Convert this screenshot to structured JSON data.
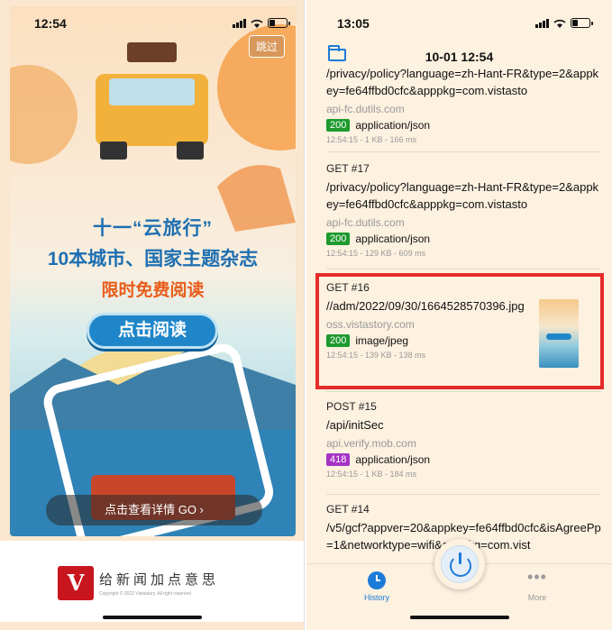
{
  "left": {
    "status_time": "12:54",
    "skip_label": "跳过",
    "headline1": "十一“云旅行”",
    "headline2": "10本城市、国家主题杂志",
    "headline3": "限时免费阅读",
    "read_button": "点击阅读",
    "details_button": "点击查看详情 GO ›",
    "slogan": "给新闻加点意思",
    "copyright": "Copyright © 2022 Vistastory. All right reserved",
    "colors": {
      "headline": "#1d6fb2",
      "accent": "#e85d1a",
      "logo": "#c9151e"
    }
  },
  "right": {
    "status_time": "13:05",
    "nav_title": "10-01 12:54",
    "requests": [
      {
        "method": "",
        "path": "/privacy/policy?language=zh-Hant-FR&type=2&appkey=fe64ffbd0cfc&apppkg=com.vistasto",
        "host": "api-fc.dutils.com",
        "code": "200",
        "content_type": "application/json",
        "meta": "12:54:15 - 1 KB - 166 ms"
      },
      {
        "method": "GET  #17",
        "path": "/privacy/policy?language=zh-Hant-FR&type=2&appkey=fe64ffbd0cfc&apppkg=com.vistasto",
        "host": "api-fc.dutils.com",
        "code": "200",
        "content_type": "application/json",
        "meta": "12:54:15 - 129 KB - 609 ms"
      },
      {
        "method": "GET  #16",
        "path": "//adm/2022/09/30/1664528570396.jpg",
        "host": "oss.vistastory.com",
        "code": "200",
        "content_type": "image/jpeg",
        "meta": "12:54:15 - 139 KB - 138 ms"
      },
      {
        "method": "POST  #15",
        "path": "/api/initSec",
        "host": "api.verify.mob.com",
        "code": "418",
        "content_type": "application/json",
        "meta": "12:54:15 - 1 KB - 184 ms"
      },
      {
        "method": "GET  #14",
        "path": "/v5/gcf?appver=20&appkey=fe64ffbd0cfc&isAgreePp=1&networktype=wifi&apppkg=com.vist",
        "host": "",
        "code": "",
        "content_type": "",
        "meta": ""
      }
    ],
    "tabs": {
      "history": "History",
      "more": "More"
    },
    "colors": {
      "ok": "#1e9a2d",
      "teapot": "#a633c4",
      "highlight": "#e62b2b",
      "accent": "#1d7bd8"
    }
  }
}
